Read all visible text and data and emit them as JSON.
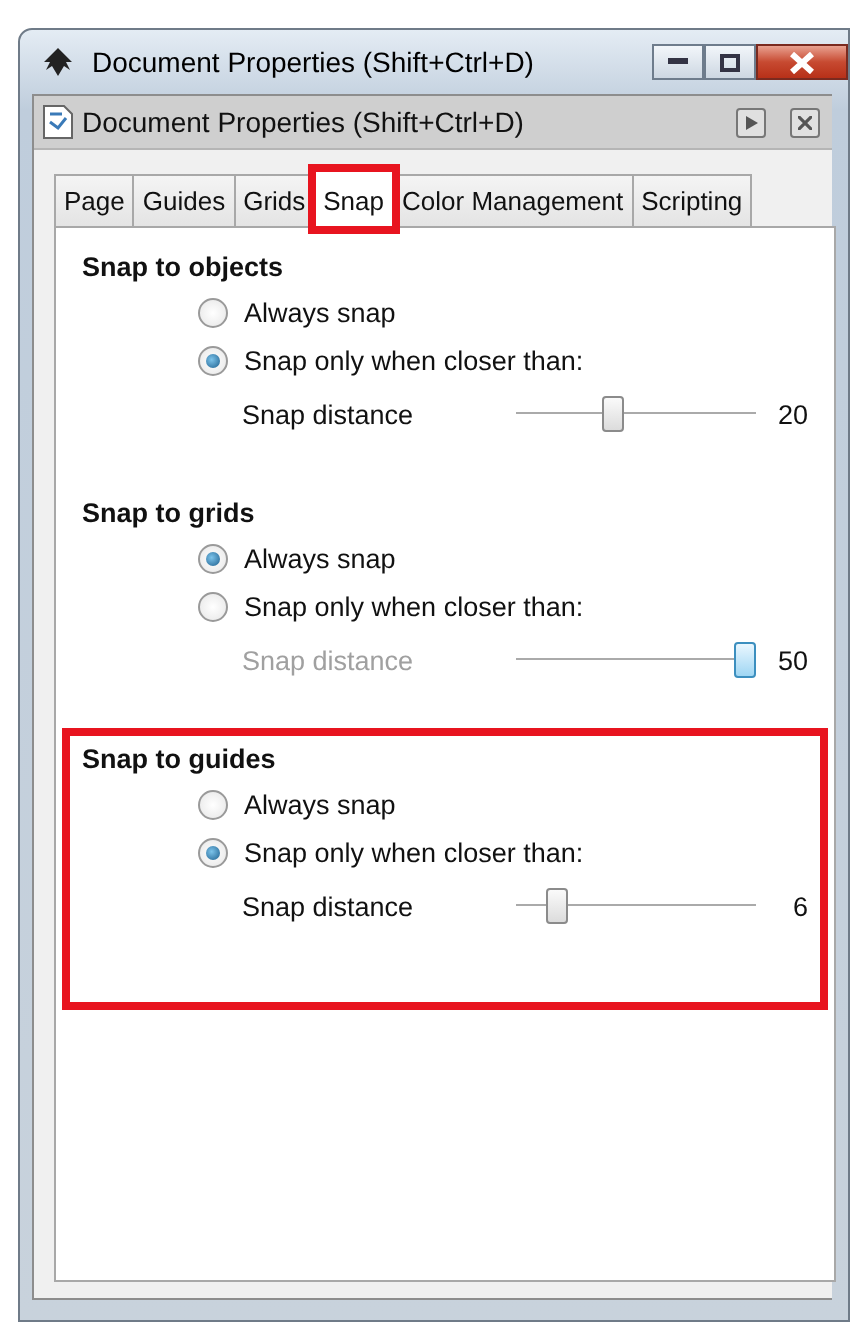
{
  "window": {
    "title": "Document Properties (Shift+Ctrl+D)"
  },
  "panel": {
    "title": "Document Properties (Shift+Ctrl+D)"
  },
  "tabs": [
    {
      "label": "Page",
      "selected": false,
      "highlighted": false
    },
    {
      "label": "Guides",
      "selected": false,
      "highlighted": false
    },
    {
      "label": "Grids",
      "selected": false,
      "highlighted": false
    },
    {
      "label": "Snap",
      "selected": true,
      "highlighted": true
    },
    {
      "label": "Color Management",
      "selected": false,
      "highlighted": false
    },
    {
      "label": "Scripting",
      "selected": false,
      "highlighted": false
    }
  ],
  "sections": [
    {
      "title": "Snap to objects",
      "highlighted": false,
      "options": [
        {
          "label": "Always snap",
          "selected": false
        },
        {
          "label": "Snap only when closer than:",
          "selected": true
        }
      ],
      "slider": {
        "label": "Snap distance",
        "disabled": false,
        "level": 0.4,
        "reading": "20"
      }
    },
    {
      "title": "Snap to grids",
      "highlighted": false,
      "options": [
        {
          "label": "Always snap",
          "selected": true
        },
        {
          "label": "Snap only when closer than:",
          "selected": false
        }
      ],
      "slider": {
        "label": "Snap distance",
        "disabled": true,
        "level": 1,
        "reading": "50"
      }
    },
    {
      "title": "Snap to guides",
      "highlighted": true,
      "options": [
        {
          "label": "Always snap",
          "selected": false
        },
        {
          "label": "Snap only when closer than:",
          "selected": true
        }
      ],
      "slider": {
        "label": "Snap distance",
        "disabled": false,
        "level": 0.14,
        "reading": "6"
      }
    }
  ]
}
